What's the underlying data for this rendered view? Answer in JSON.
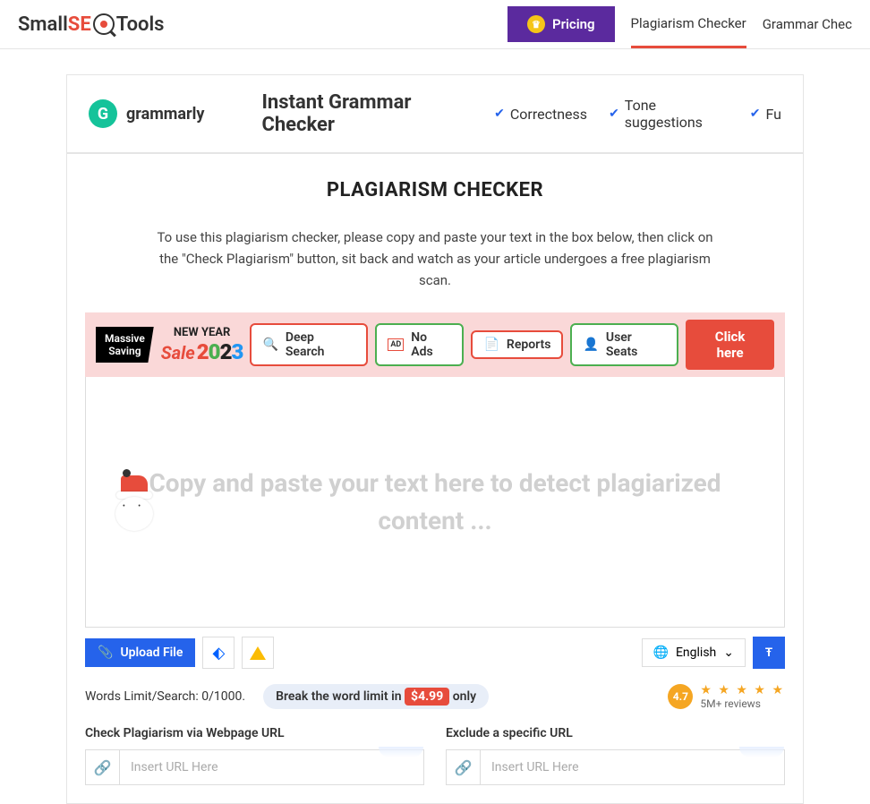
{
  "header": {
    "logo_parts": {
      "small": "Small",
      "s": "S",
      "e": "E",
      "tools": "Tools"
    },
    "pricing": "Pricing",
    "nav_links": [
      "Plagiarism Checker",
      "Grammar Chec"
    ]
  },
  "grammarly": {
    "brand": "grammarly",
    "title": "Instant Grammar Checker",
    "features": [
      "Correctness",
      "Tone suggestions",
      "Fu"
    ]
  },
  "page": {
    "title": "PLAGIARISM CHECKER",
    "instructions": "To use this plagiarism checker, please copy and paste your text in the box below, then click on the \"Check Plagiarism\" button, sit back and watch as your article undergoes a free plagiarism scan."
  },
  "promo": {
    "massive": "Massive",
    "saving": "Saving",
    "sale": "Sale",
    "new_year": "NEW YEAR",
    "pills": [
      "Deep Search",
      "No Ads",
      "Reports",
      "User Seats"
    ],
    "cta": "Click here"
  },
  "editor": {
    "placeholder": "Copy and paste your text here to detect plagiarized content ..."
  },
  "toolbar": {
    "upload": "Upload File",
    "language": "English"
  },
  "stats": {
    "words_limit": "Words Limit/Search: 0/1000.",
    "break_pre": "Break the word limit in ",
    "price": "$4.99",
    "break_post": " only",
    "rating": "4.7",
    "reviews": "5M+ reviews"
  },
  "urls": {
    "check_label": "Check Plagiarism via Webpage URL",
    "exclude_label": "Exclude a specific URL",
    "placeholder": "Insert URL Here"
  }
}
